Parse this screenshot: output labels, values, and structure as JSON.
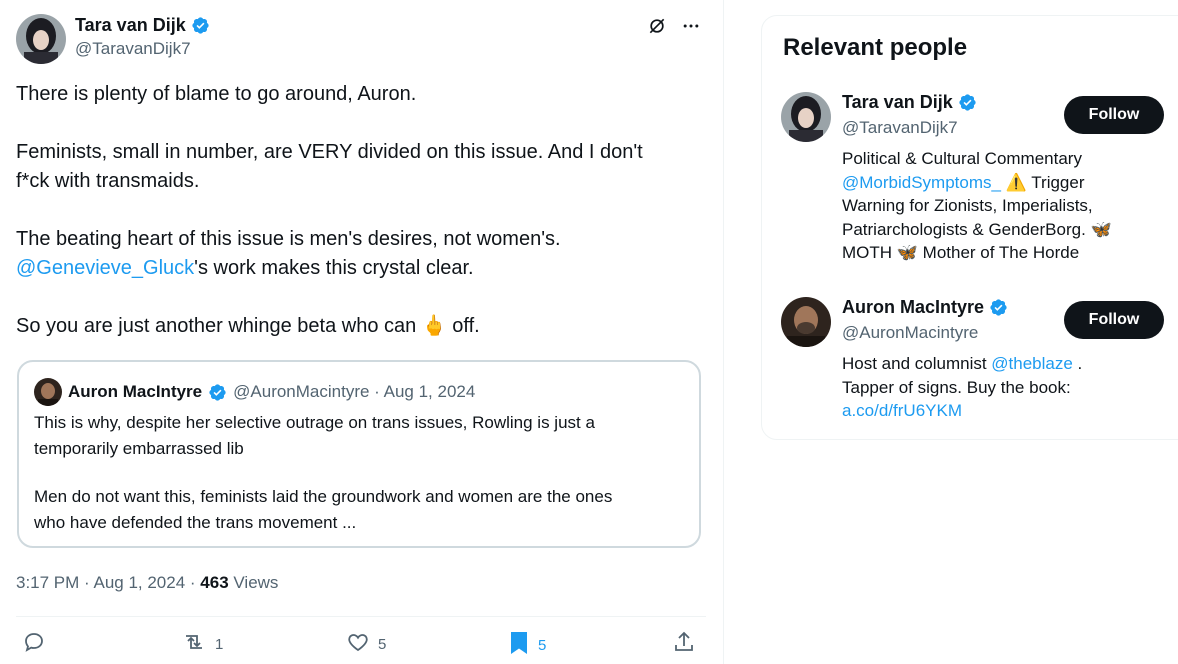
{
  "tweet": {
    "author_name": "Tara van Dijk",
    "author_handle": "@TaravanDijk7",
    "text": {
      "line1": "There is plenty of blame to go around, Auron.",
      "line2": "Feminists, small in number, are VERY divided on this issue. And I don't",
      "line3": "f*ck with transmaids.",
      "line4": "The beating heart of this issue is men's desires, not women's.",
      "mention": "@Genevieve_Gluck",
      "line5_rest": "'s work makes this crystal clear.",
      "line6_a": "So you are just another whinge beta who can",
      "emoji": "🖕",
      "line6_b": "off."
    },
    "timestamp": "3:17 PM · Aug 1, 2024 · ",
    "views_count": "463",
    "views_label": "Views",
    "actions": {
      "replies": "",
      "retweets": "1",
      "likes": "5",
      "bookmarks": "5"
    }
  },
  "quote": {
    "author_name": "Auron MacIntyre",
    "meta": "@AuronMacintyre · Aug 1, 2024",
    "line1": "This is why, despite her selective outrage on trans issues, Rowling is just a",
    "line2": "temporarily embarrassed lib",
    "line3": "Men do not want this, feminists laid the groundwork and women are the ones",
    "line4": "who have defended the trans movement  ..."
  },
  "sidebar": {
    "title": "Relevant people",
    "people": [
      {
        "name": "Tara van Dijk",
        "handle": "@TaravanDijk7",
        "follow_label": "Follow",
        "bio_line1": "Political & Cultural Commentary",
        "bio_mention": "@MorbidSymptoms_",
        "bio_line2_rest": " ⚠️ Trigger",
        "bio_line3": "Warning for Zionists, Imperialists,",
        "bio_line4": "Patriarchologists & GenderBorg. 🦋",
        "bio_line5": "MOTH 🦋 Mother of The Horde"
      },
      {
        "name": "Auron MacIntyre",
        "handle": "@AuronMacintyre",
        "follow_label": "Follow",
        "bio_line1_a": "Host and columnist ",
        "bio_mention": "@theblaze",
        "bio_line1_b": " .",
        "bio_line2": "Tapper of signs. Buy the book:",
        "bio_link": "a.co/d/frU6YKM"
      }
    ]
  },
  "colors": {
    "accent": "#1d9bf0",
    "text": "#0f1419",
    "secondary": "#536471",
    "border": "#cfd9de"
  },
  "icons": [
    "verified-badge-icon",
    "grok-icon",
    "more-icon",
    "reply-icon",
    "retweet-icon",
    "like-icon",
    "bookmark-icon",
    "share-icon"
  ]
}
